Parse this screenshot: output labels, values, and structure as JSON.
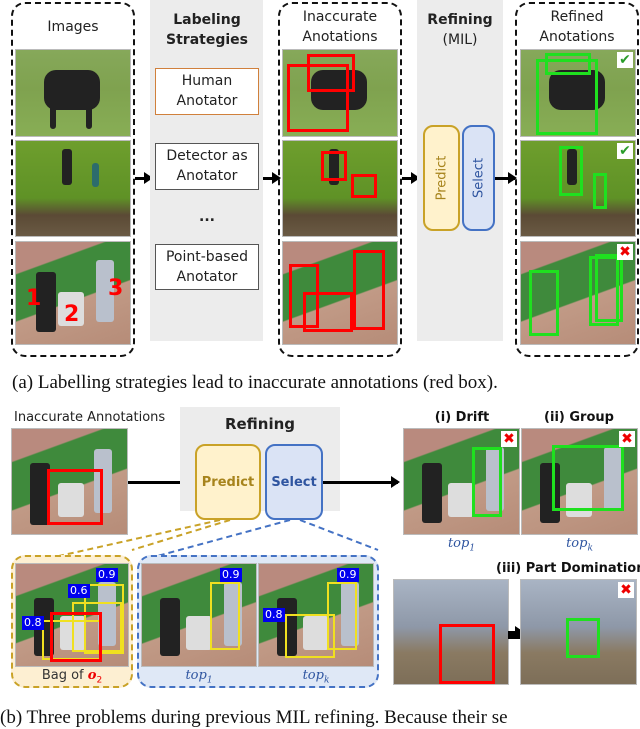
{
  "part_a": {
    "images_title": "Images",
    "labeling": {
      "title": "Labeling Strategies",
      "options": [
        "Human Anotator",
        "Detector as Anotator",
        "...",
        "Point-based Anotator"
      ]
    },
    "inaccurate_title": "Inaccurate Anotations",
    "refining_title": "Refining",
    "refining_sub": "(MIL)",
    "predict_label": "Predict",
    "select_label": "Select",
    "refined_title": "Refined Anotations",
    "point_numbers": [
      "1",
      "2",
      "3"
    ],
    "results": [
      "correct",
      "correct",
      "wrong"
    ],
    "check_glyph": "✔",
    "cross_glyph": "✖",
    "caption": "(a) Labelling strategies lead to inaccurate annotations (red box)."
  },
  "part_b": {
    "inaccurate_label": "Inaccurate Annotations",
    "refining_title": "Refining",
    "predict_label": "Predict",
    "select_label": "Select",
    "bag_label": "Bag of ",
    "bag_var": "o",
    "bag_sub": "2",
    "bag_scores": [
      "0.9",
      "0.6",
      "0.8"
    ],
    "top1_scores": [
      "0.9"
    ],
    "topk_scores": [
      "0.9",
      "0.8"
    ],
    "top1_label": "top",
    "top1_sub": "1",
    "topk_label": "top",
    "topk_sub": "k",
    "problems": [
      {
        "title": "(i) Drift",
        "sub_label": "top",
        "sub": "1"
      },
      {
        "title": "(ii) Group",
        "sub_label": "top",
        "sub": "k"
      },
      {
        "title": "(iii) Part Domination"
      }
    ],
    "caption": "(b) Three problems during previous MIL refining. Because their se"
  },
  "colors": {
    "inaccurate": "#ff0000",
    "refined": "#1fe01f",
    "proposal": "#f0e020",
    "predict": "#c9a227",
    "select": "#4472c4",
    "score_bg": "#0000ee"
  }
}
